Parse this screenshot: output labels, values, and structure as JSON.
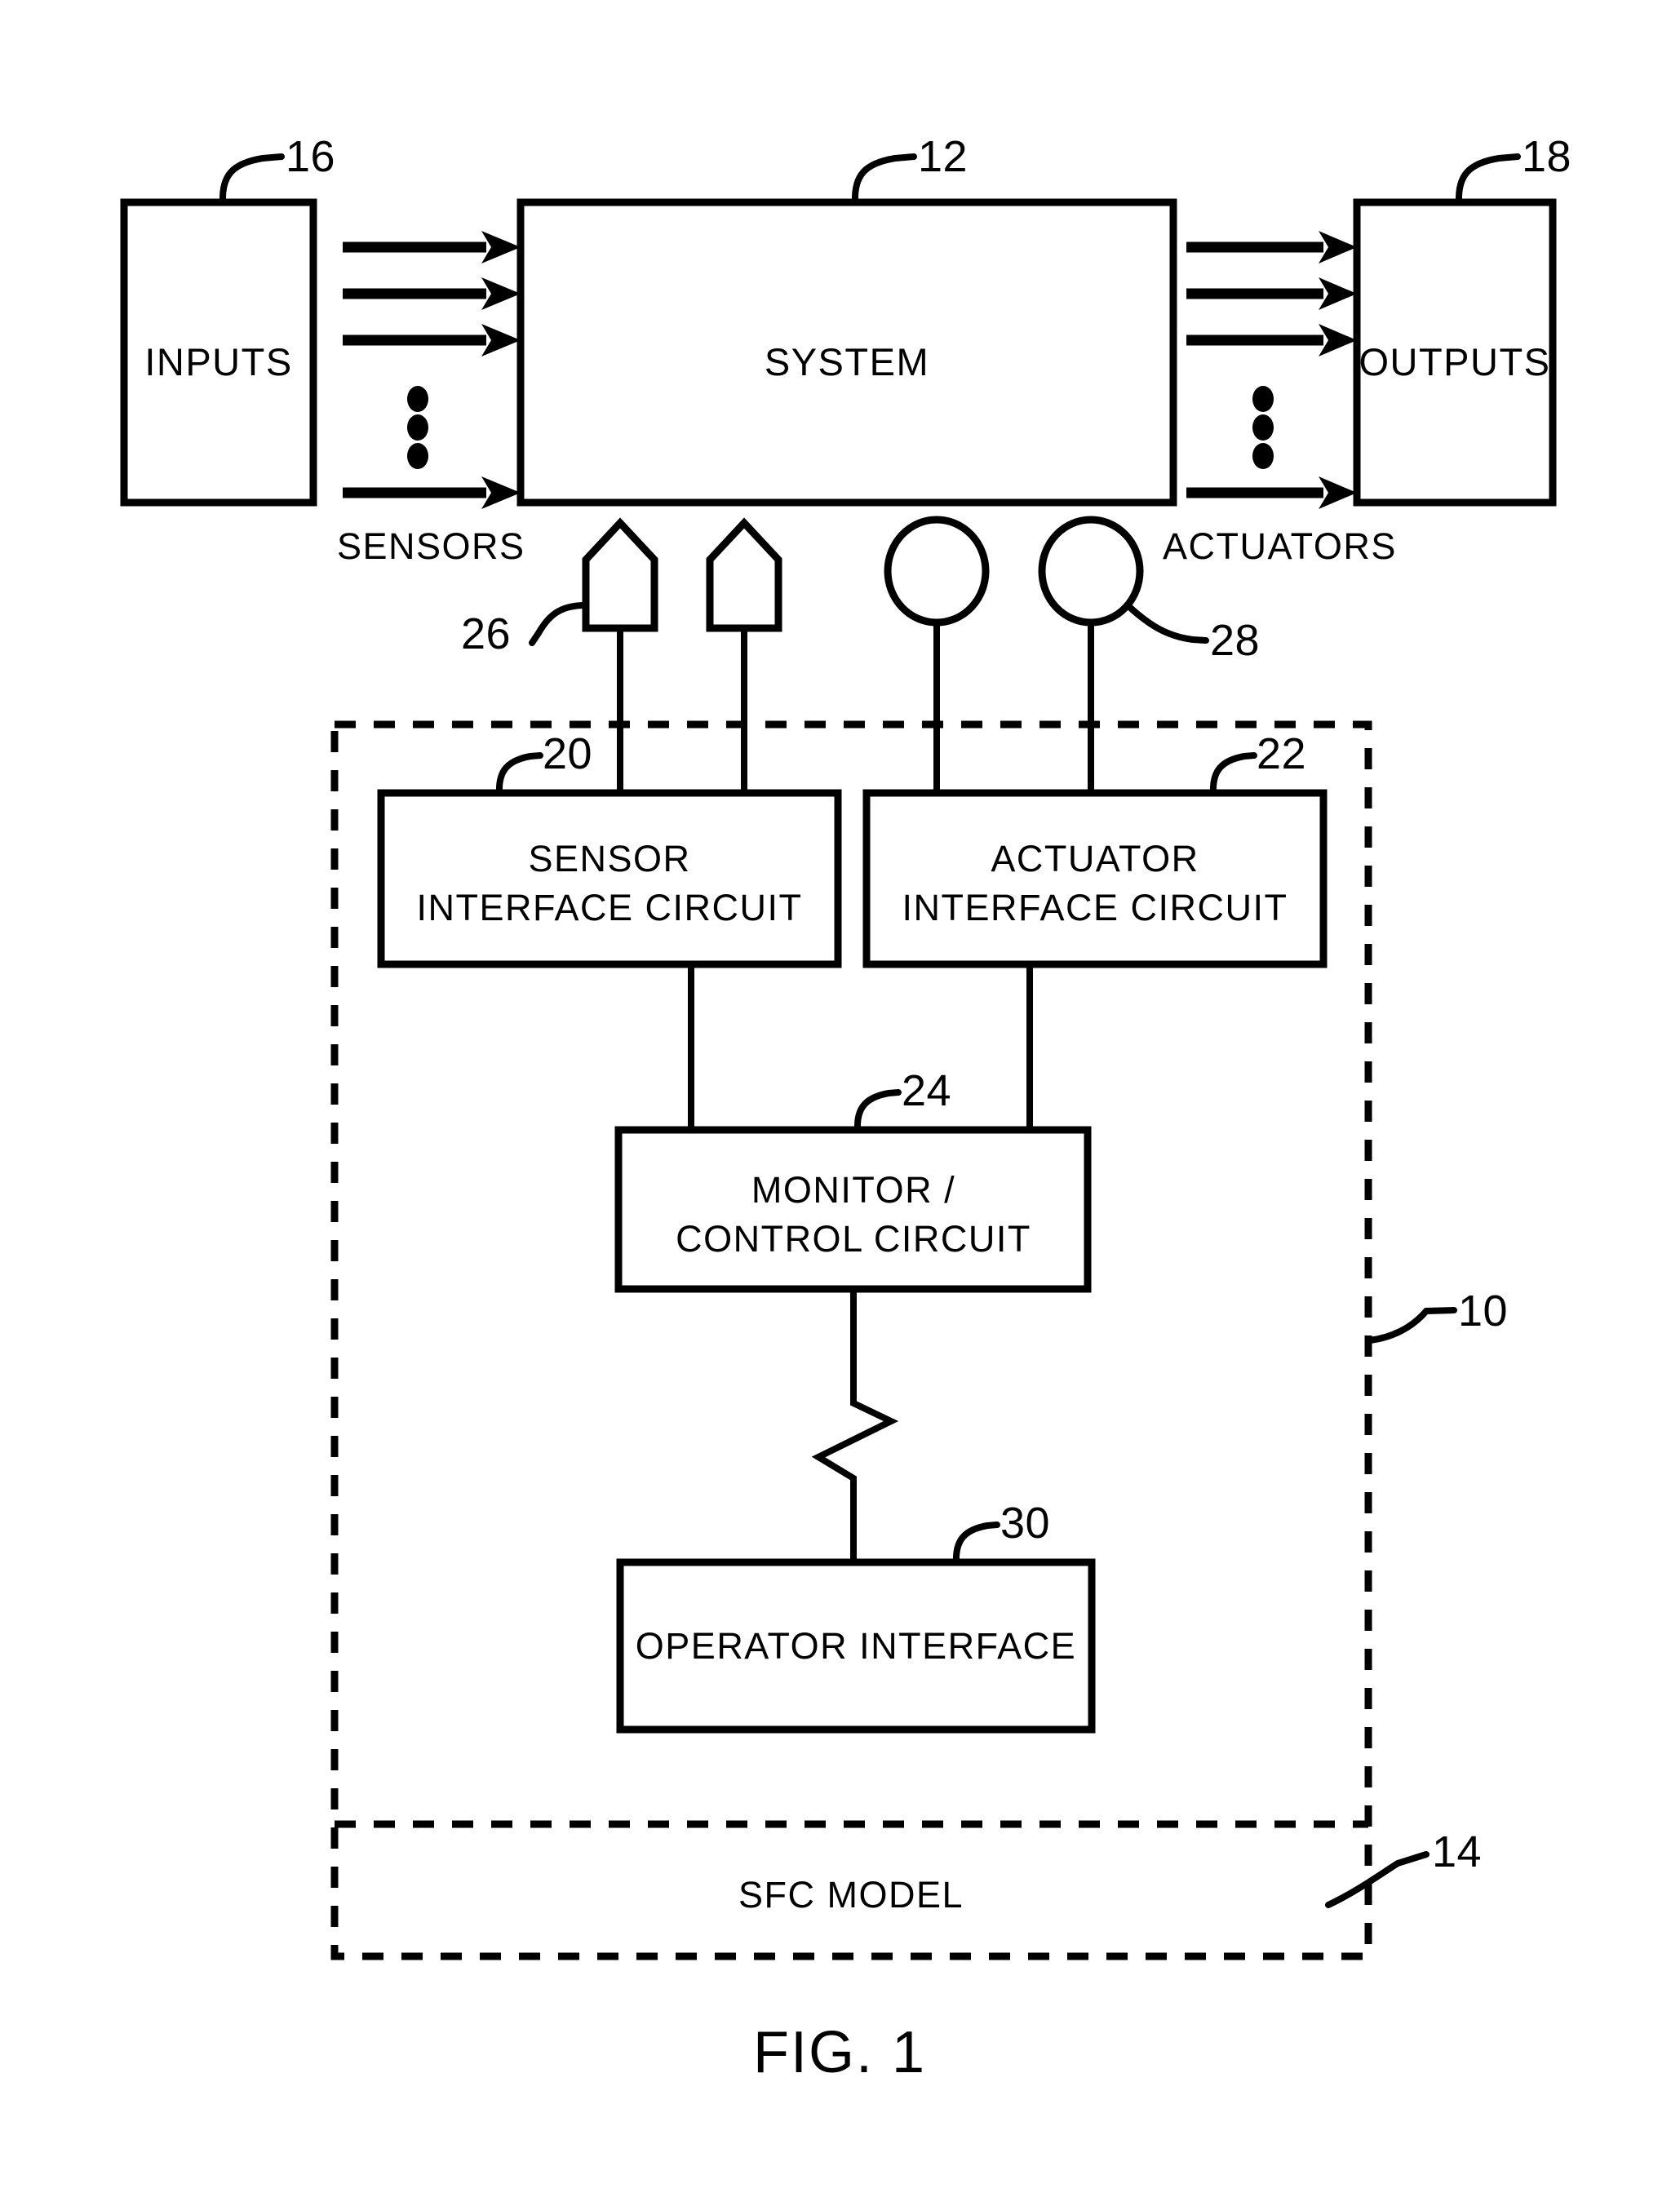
{
  "figure": {
    "caption": "FIG. 1",
    "title_blocks": {
      "inputs": "INPUTS",
      "system": "SYSTEM",
      "outputs": "OUTPUTS",
      "sensor_interface_line1": "SENSOR",
      "sensor_interface_line2": "INTERFACE CIRCUIT",
      "actuator_interface_line1": "ACTUATOR",
      "actuator_interface_line2": "INTERFACE CIRCUIT",
      "monitor_control_line1": "MONITOR /",
      "monitor_control_line2": "CONTROL CIRCUIT",
      "operator_interface": "OPERATOR  INTERFACE",
      "sfc_model": "SFC MODEL"
    },
    "edge_labels": {
      "sensors": "SENSORS",
      "actuators": "ACTUATORS"
    },
    "reference_numerals": {
      "system": "12",
      "inputs": "16",
      "outputs": "18",
      "sensor_interface_circuit": "20",
      "actuator_interface_circuit": "22",
      "monitor_control_circuit": "24",
      "sensor_symbol": "26",
      "actuator_symbol": "28",
      "operator_interface": "30",
      "dashed_enclosure": "10",
      "sfc_model": "14"
    },
    "colors": {
      "ink": "#000000",
      "paper": "#ffffff"
    }
  }
}
